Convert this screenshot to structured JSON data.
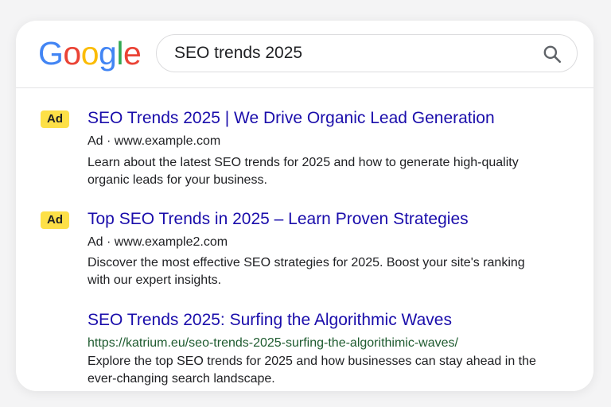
{
  "logo": {
    "letters": [
      {
        "char": "G",
        "color": "#4285F4"
      },
      {
        "char": "o",
        "color": "#EA4335"
      },
      {
        "char": "o",
        "color": "#FBBC05"
      },
      {
        "char": "g",
        "color": "#4285F4"
      },
      {
        "char": "l",
        "color": "#34A853"
      },
      {
        "char": "e",
        "color": "#EA4335"
      }
    ]
  },
  "search": {
    "query": "SEO trends 2025",
    "icon": "search-icon"
  },
  "results": [
    {
      "badge": "Ad",
      "title": "SEO Trends 2025 | We Drive Organic Lead Generation",
      "url": "Ad · www.example.com",
      "description": "Learn about the latest SEO trends for 2025 and how to generate high-quality organic leads for your business."
    },
    {
      "badge": "Ad",
      "title": "Top SEO Trends in 2025 – Learn Proven Strategies",
      "url": "Ad · www.example2.com",
      "description": "Discover the most effective SEO strategies for 2025. Boost your site's ranking with our expert insights."
    },
    {
      "title": "SEO Trends 2025: Surfing the Algorithmic Waves",
      "url": "https://katrium.eu/seo-trends-2025-surfing-the-algorithimic-waves/",
      "description": "Explore the top SEO trends for 2025 and how businesses can stay ahead in the ever-changing search landscape."
    }
  ],
  "colors": {
    "link": "#1a0dab",
    "organic_url": "#1e5b2f",
    "ad_badge": "#fde047"
  }
}
